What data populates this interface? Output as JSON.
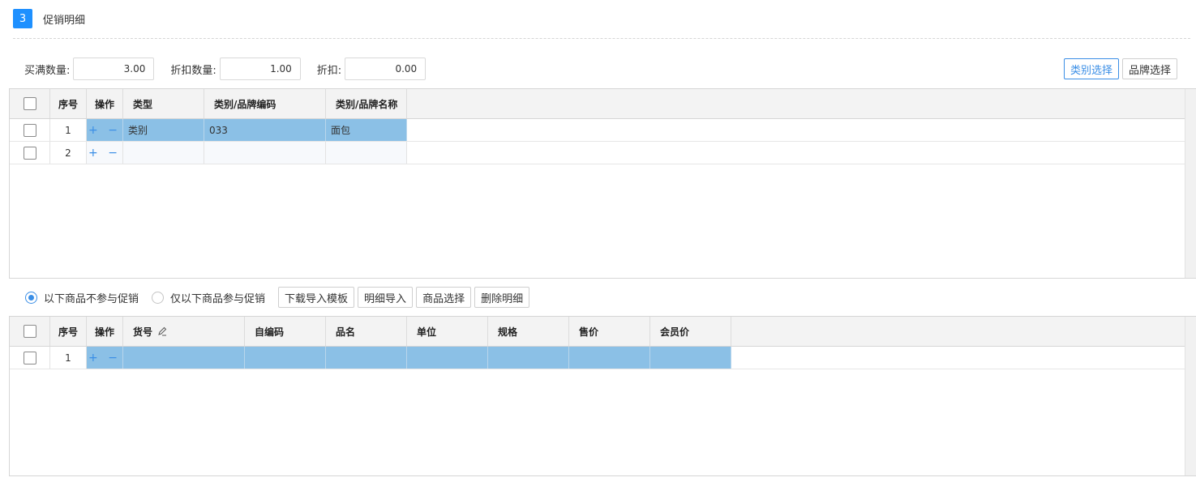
{
  "section": {
    "step": "3",
    "title": "促销明细"
  },
  "form": {
    "buy_qty_label": "买满数量:",
    "buy_qty_value": "3.00",
    "discount_qty_label": "折扣数量:",
    "discount_qty_value": "1.00",
    "discount_label": "折扣:",
    "discount_value": "0.00"
  },
  "top_buttons": {
    "category_select": "类别选择",
    "brand_select": "品牌选择"
  },
  "grid1": {
    "headers": {
      "seq": "序号",
      "ops": "操作",
      "type": "类型",
      "code": "类别/品牌编码",
      "name": "类别/品牌名称"
    },
    "rows": [
      {
        "seq": "1",
        "ops": "+ −",
        "type": "类别",
        "code": "033",
        "name": "面包"
      },
      {
        "seq": "2",
        "ops": "+ −",
        "type": "",
        "code": "",
        "name": ""
      }
    ]
  },
  "mode": {
    "exclude_label": "以下商品不参与促销",
    "include_label": "仅以下商品参与促销",
    "selected": "exclude"
  },
  "mid_buttons": {
    "download_template": "下载导入模板",
    "import_detail": "明细导入",
    "goods_select": "商品选择",
    "delete_detail": "删除明细"
  },
  "grid2": {
    "headers": {
      "seq": "序号",
      "ops": "操作",
      "item_no": "货号",
      "self_code": "自编码",
      "product_name": "品名",
      "unit": "单位",
      "spec": "规格",
      "price": "售价",
      "member_price": "会员价"
    },
    "rows": [
      {
        "seq": "1",
        "ops": "+ −"
      }
    ]
  },
  "icons": {
    "edit": "pencil-icon",
    "checkbox": "checkbox-icon"
  },
  "colors": {
    "accent": "#1e90ff",
    "selected_row": "#8bc0e6",
    "link": "#3a8ee6"
  }
}
